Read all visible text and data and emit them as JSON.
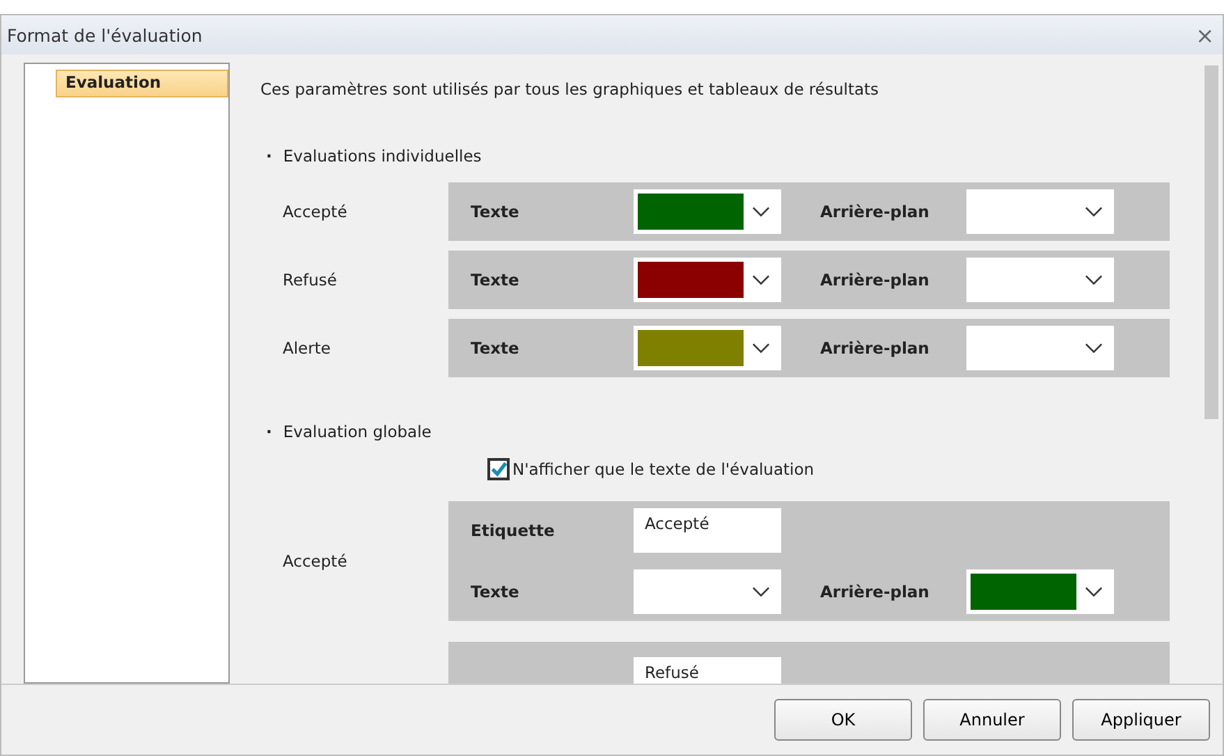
{
  "window": {
    "title": "Format de l'évaluation",
    "close": "×"
  },
  "sidebar": {
    "items": [
      {
        "label": "Evaluation",
        "selected": true
      }
    ]
  },
  "intro": "Ces paramètres sont utilisés par tous les graphiques et tableaux de résultats",
  "individual": {
    "heading": "Evaluations individuelles",
    "bullet": "·",
    "rows": [
      {
        "label": "Accepté",
        "text": {
          "label": "Texte",
          "color": "#006400"
        },
        "background": {
          "label": "Arrière-plan"
        }
      },
      {
        "label": "Refusé",
        "text": {
          "label": "Texte",
          "color": "#8b0000"
        },
        "background": {
          "label": "Arrière-plan"
        }
      },
      {
        "label": "Alerte",
        "text": {
          "label": "Texte",
          "color": "#808000"
        },
        "background": {
          "label": "Arrière-plan"
        }
      }
    ]
  },
  "global": {
    "heading": "Evaluation globale",
    "bullet": "·",
    "checkbox": {
      "label": "N'afficher que le texte de l'évaluation",
      "checked": true
    },
    "groups": [
      {
        "label": "Accepté",
        "etiquette_label": "Etiquette",
        "etiquette_value": "Accepté",
        "text": {
          "label": "Texte"
        },
        "background": {
          "label": "Arrière-plan",
          "color": "#006400"
        }
      },
      {
        "etiquette_value": "Refusé"
      }
    ]
  },
  "buttons": [
    "OK",
    "Annuler",
    "Appliquer"
  ]
}
